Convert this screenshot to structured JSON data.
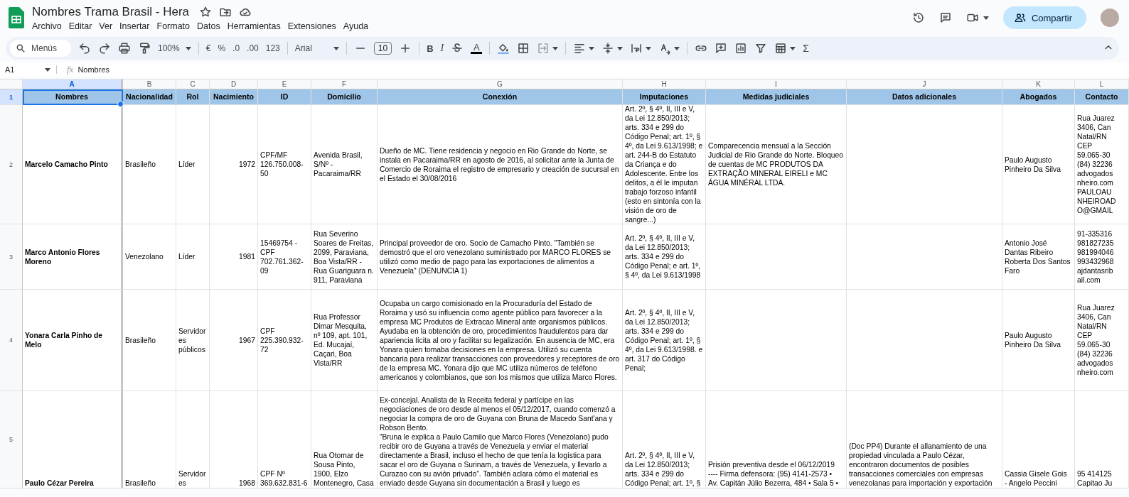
{
  "document": {
    "title": "Nombres Trama Brasil - Hera",
    "menu": [
      "Archivo",
      "Editar",
      "Ver",
      "Insertar",
      "Formato",
      "Datos",
      "Herramientas",
      "Extensiones",
      "Ayuda"
    ]
  },
  "share": {
    "label": "Compartir"
  },
  "toolbar": {
    "search": {
      "placeholder": "Menús"
    },
    "zoom": "100%",
    "currency": "€",
    "percent": "%",
    "decimals_decrease": ".0",
    "decimals_increase": ".00",
    "number_format": "123",
    "font": "Arial",
    "font_size": "10",
    "bold": "B",
    "italic": "I",
    "text_color": "A",
    "functions": "Σ"
  },
  "formula_bar": {
    "cell_ref": "A1",
    "fx": "fx",
    "value": "Nombres"
  },
  "sheet": {
    "columns": [
      {
        "letter": "A",
        "kind": "name",
        "selected": true
      },
      {
        "letter": "B",
        "kind": "text",
        "selected": false
      },
      {
        "letter": "C",
        "kind": "text",
        "selected": false
      },
      {
        "letter": "D",
        "kind": "number",
        "selected": false
      },
      {
        "letter": "E",
        "kind": "text",
        "selected": false
      },
      {
        "letter": "F",
        "kind": "text",
        "selected": false
      },
      {
        "letter": "G",
        "kind": "text",
        "selected": false
      },
      {
        "letter": "H",
        "kind": "text",
        "selected": false
      },
      {
        "letter": "I",
        "kind": "text",
        "selected": false
      },
      {
        "letter": "J",
        "kind": "text",
        "selected": false
      },
      {
        "letter": "K",
        "kind": "text",
        "selected": false
      },
      {
        "letter": "L",
        "kind": "text",
        "selected": false
      }
    ],
    "rows": [
      {
        "number": "1",
        "kind": "header",
        "selected": true,
        "cells": [
          "Nombres",
          "Nacionalidad",
          "Rol",
          "Nacimiento",
          "ID",
          "Domicilio",
          "Conexión",
          "Imputaciones",
          "Medidas judiciales",
          "Datos adicionales",
          "Abogados",
          "Contacto"
        ]
      },
      {
        "number": "2",
        "kind": "data",
        "selected": false,
        "cells": [
          "Marcelo Camacho Pinto",
          "Brasileño",
          "Líder",
          "1972",
          "CPF/MF 126.750.008-50",
          "Avenida Brasil, S/Nº - Pacaraima/RR",
          "Dueño de MC. Tiene residencia y negocio en Rio Grande do Norte, se instala en Pacaraima/RR en agosto de 2016, al solicitar ante la Junta de Comercio de Roraima el registro de empresario y creación de sucursal en el Estado el 30/08/2016",
          "Art. 2º, § 4º, II, III e V, da Lei 12.850/2013; arts. 334 e 299 do Código Penal; art. 1º, § 4º, da Lei 9.613/1998; e art. 244-B do Estatuto da Criança e do Adolescente. Entre los delitos, a él le imputan trabajo forzoso infantil (esto en sintonía con la visión de oro de sangre...)",
          "Comparecencia mensual a la Sección Judicial de Rio Grande do Norte. Bloqueo de cuentas de MC PRODUTOS DA EXTRAÇÃO MINERAL EIRELI e MC ÁGUA MINÉRAL LTDA.",
          "",
          "Paulo Augusto Pinheiro Da Silva",
          "Rua Juarez\n3406, Can\nNatal/RN\nCEP\n59.065-30\n(84) 32236\nadvogados\nnheiro.com\nPAULOAU\nNHEIROAD\nO@GMAIL"
        ]
      },
      {
        "number": "3",
        "kind": "data",
        "selected": false,
        "cells": [
          "Marco Antonio Flores Moreno",
          "Venezolano",
          "Líder",
          "1981",
          "15469754 - CPF 702.761.362-09",
          "Rua Severino Soares de Freitas, 2099, Paraviana, Boa Vista/RR - Rua Guariguara n. 911, Paraviana",
          "Principal proveedor de oro. Socio de Camacho Pinto. \"También se demostró que el oro venezolano suministrado por MARCO FLORES se utilizó como medio de pago para las exportaciones de alimentos a Venezuela\" (DENUNCIA 1)",
          "Art. 2º, § 4º, II, III e V, da Lei 12.850/2013; arts. 334 e 299 do Código Penal; e art. 1º, § 4º, da Lei 9.613/1998",
          "",
          "",
          "Antonio José Dantas Ribeiro Roberta Dos Santos Faro",
          "91-335316\n981827235\n981994046\n993432968\najdantasrib\nail.com"
        ]
      },
      {
        "number": "4",
        "kind": "data",
        "selected": false,
        "cells": [
          "Yonara Carla Pinho de Melo",
          "Brasileño",
          "Servidor es públicos",
          "1967",
          "CPF 225.390.932-72",
          "Rua Professor Dimar Mesquita, nº 109, apt. 101, Ed. Mucajaí, Caçari, Boa Vista/RR",
          "Ocupaba un cargo comisionado en la Procuraduría del Estado de Roraima y usó su influencia como agente público para favorecer a la empresa MC Produtos de Extracao Mineral ante organismos públicos. Ayudaba en la obtención de oro, procedimientos fraudulentos para dar apariencia lícita al oro y facilitar su legalización. En ausencia de MC, era Yonara quien tomaba decisiones en la empresa. Utilizó su cuenta bancaria para realizar transacciones con proveedores y receptores de oro de la empresa MC. Yonara dijo que MC utiliza números de teléfono americanos y colombianos, que son los mismos que utiliza Marco Flores.",
          "Art. 2º, § 4º, II, III e V, da Lei 12.850/2013; arts. 334 e 299 do Código Penal; art. 1º, § 4º, da Lei 9.613/1998. e art. 317 do Código Penal;",
          "",
          "",
          "Paulo Augusto Pinheiro Da Silva",
          "Rua Juarez\n3406, Can\nNatal/RN\nCEP\n59.065-30\n(84) 32236\nadvogados\nnheiro.com"
        ]
      },
      {
        "number": "5",
        "kind": "data",
        "selected": false,
        "cells": [
          "Paulo Cézar Pereira",
          "Brasileño",
          "Servidor\nes",
          "1968",
          "CPF Nº\n369.632.831-6",
          "Rua Otomar de\nSousa Pinto,\n1900, Elzo\nMontenegro, Casa",
          "Ex-concejal. Analista de la Receita federal y partícipe en las negociaciones de oro desde al menos el 05/12/2017, cuando comenzó a negociar la compra de oro de Guyana con Bruna de Macedo Sant'ana y Robson Bento.\n“Bruna le explica a Paulo Camilo que Marco Flores (Venezolano) pudo recibir oro de Guyana a través de Venezuela y enviar el material directamente a Brasil, incluso el hecho de que tenía la logística para sacar el oro de Guyana o Surinam, a través de Venezuela, y llevarlo a Curazao con su avión privado”. También aclara cómo el material es enviado desde Guyana sin documentación a Brasil y luego es",
          "Art. 2º, § 4º, II, III e V,\nda Lei 12.850/2013;\narts. 334 e 299 do\nCódigo Penal; art. 1º, §",
          "Prisión preventiva desde el 06/12/2019\n---- Firma defensora: (95) 4141-2573 •\nAv. Capitán Júlio Bezerra, 484 • Sala 5 •",
          "(Doc PP4) Durante el allanamiento de una\npropiedad vinculada a Paulo Cézar,\nencontraron documentos de posibles\ntransacciones comerciales con empresas\nvenezolanas para importación y exportación",
          "Cassia Gisele Gois\n- Angelo Peccini",
          "95 414125\nCapitao Ju"
        ]
      }
    ]
  }
}
